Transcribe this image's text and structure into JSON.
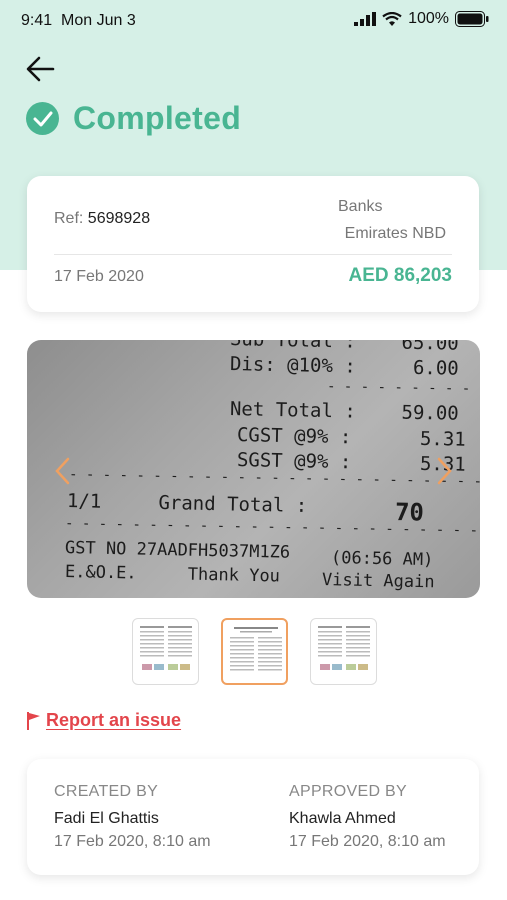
{
  "status_bar": {
    "time": "9:41",
    "date": "Mon Jun 3",
    "battery": "100%"
  },
  "header": {
    "title": "Completed"
  },
  "summary": {
    "ref_label": "Ref:",
    "ref_value": "5698928",
    "category": "Banks",
    "bank": "Emirates NBD",
    "date": "17 Feb 2020",
    "amount": "AED 86,203"
  },
  "receipt": {
    "lines": [
      "Sub Total :    65.00",
      "Dis: @10% :     6.00",
      "Net Total :    59.00",
      "CGST @9% :      5.31",
      "SGST @9% :      5.31",
      "1/1     Grand Total :",
      "70",
      "GST NO 27AADFH5037M1Z6",
      "(06:56 AM)",
      "E.&O.E.     Thank You",
      "Visit Again"
    ]
  },
  "report": {
    "label": "Report an issue"
  },
  "people": {
    "created_head": "CREATED BY",
    "created_name": "Fadi El Ghattis",
    "created_time": "17 Feb 2020, 8:10 am",
    "approved_head": "APPROVED BY",
    "approved_name": "Khawla Ahmed",
    "approved_time": "17 Feb 2020, 8:10 am"
  },
  "colors": {
    "accent": "#49b592",
    "alert": "#e3454b",
    "header_bg": "#d6f0e7",
    "thumb_active": "#f0a060"
  }
}
